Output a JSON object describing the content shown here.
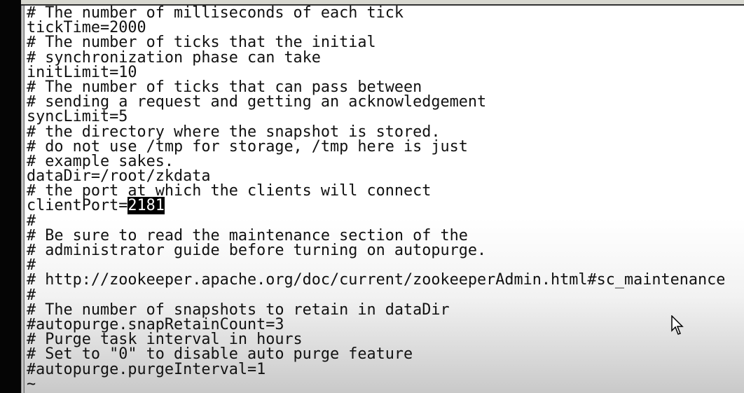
{
  "editor": {
    "lines": [
      "# The number of milliseconds of each tick",
      "tickTime=2000",
      "# The number of ticks that the initial",
      "# synchronization phase can take",
      "initLimit=10",
      "# The number of ticks that can pass between",
      "# sending a request and getting an acknowledgement",
      "syncLimit=5",
      "# the directory where the snapshot is stored.",
      "# do not use /tmp for storage, /tmp here is just",
      "# example sakes.",
      "dataDir=/root/zkdata",
      "# the port at which the clients will connect",
      "clientPort=",
      "#",
      "# Be sure to read the maintenance section of the",
      "# administrator guide before turning on autopurge.",
      "#",
      "# http://zookeeper.apache.org/doc/current/zookeeperAdmin.html#sc_maintenance",
      "#",
      "# The number of snapshots to retain in dataDir",
      "#autopurge.snapRetainCount=3",
      "# Purge task interval in hours",
      "# Set to \"0\" to disable auto purge feature",
      "#autopurge.purgeInterval=1",
      "~"
    ],
    "selected_text": "2181"
  }
}
